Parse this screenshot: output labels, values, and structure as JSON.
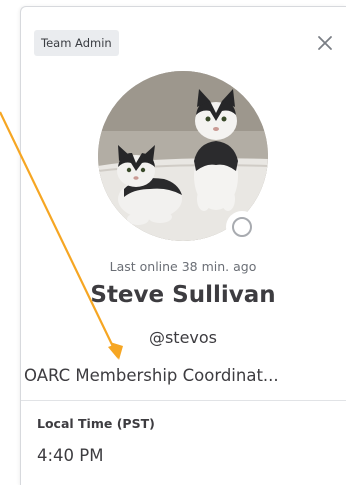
{
  "profile": {
    "role_badge": "Team Admin",
    "last_online": "Last online 38 min. ago",
    "name": "Steve Sullivan",
    "username": "@stevos",
    "position": "OARC Membership Coordinat...",
    "timezone_label": "Local Time (PST)",
    "local_time": "4:40 PM",
    "status": "offline"
  },
  "icons": {
    "close": "close-icon",
    "status": "status-offline-icon",
    "annotation": "annotation-arrow"
  },
  "colors": {
    "annotation_arrow": "#f6a623",
    "badge_bg": "#eaecef",
    "text": "#3d3c40"
  }
}
